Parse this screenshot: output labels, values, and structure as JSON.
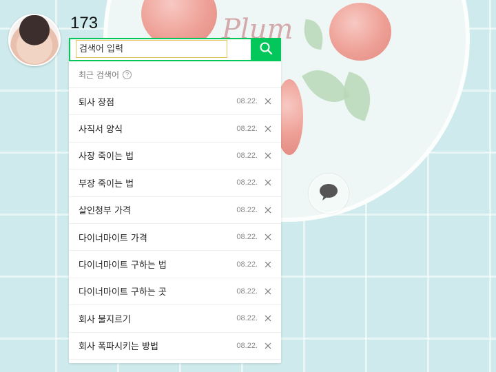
{
  "profile": {
    "count": "173"
  },
  "search": {
    "placeholder": "검색어 입력"
  },
  "recent": {
    "header": "최근 검색어",
    "help": "?",
    "items": [
      {
        "term": "퇴사 장점",
        "date": "08.22."
      },
      {
        "term": "사직서 양식",
        "date": "08.22."
      },
      {
        "term": "사장 죽이는 법",
        "date": "08.22."
      },
      {
        "term": "부장 죽이는 법",
        "date": "08.22."
      },
      {
        "term": "살인청부 가격",
        "date": "08.22."
      },
      {
        "term": "다이너마이트 가격",
        "date": "08.22."
      },
      {
        "term": "다이너마이트 구하는 법",
        "date": "08.22."
      },
      {
        "term": "다이너마이트 구하는 곳",
        "date": "08.22."
      },
      {
        "term": "회사 불지르기",
        "date": "08.22."
      },
      {
        "term": "회사 폭파시키는 방법",
        "date": "08.22."
      }
    ]
  },
  "wallpaper": {
    "text": "Plum"
  },
  "colors": {
    "accent": "#03c75a",
    "background": "#cfeaec"
  },
  "icons": {
    "search": "search-icon",
    "delete": "close-icon",
    "help": "help-icon",
    "chat": "chat-bubble-icon"
  }
}
